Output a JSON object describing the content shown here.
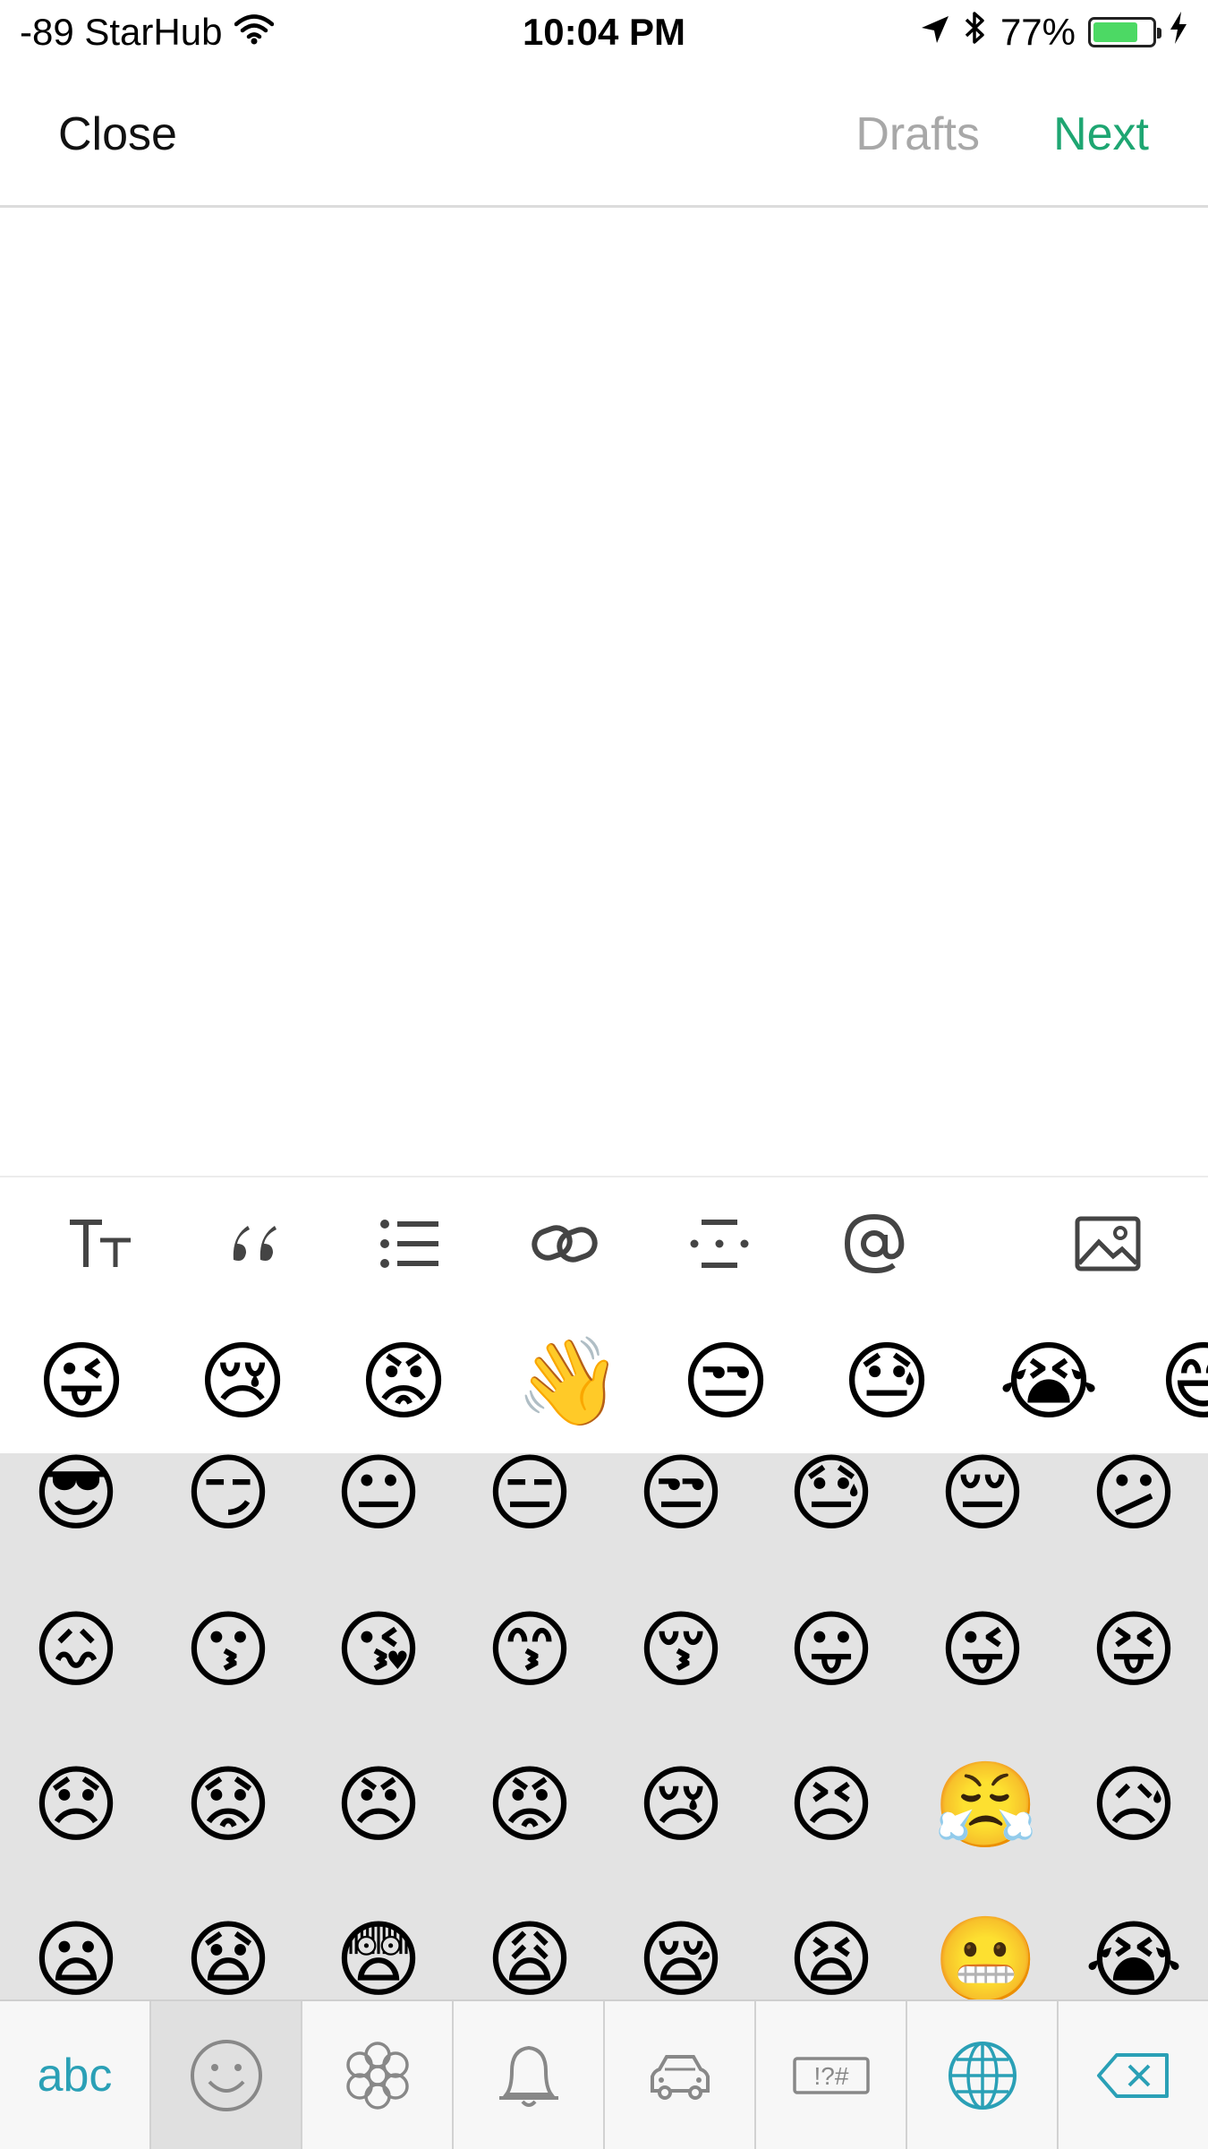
{
  "status_bar": {
    "signal": "-89 StarHub",
    "time": "10:04 PM",
    "battery": "77%",
    "battery_level": 0.77
  },
  "nav": {
    "close_label": "Close",
    "drafts_label": "Drafts",
    "next_label": "Next"
  },
  "colors": {
    "accent": "#1ea672",
    "drafts": "#a8a8a8",
    "keyboard_bg": "#e3e3e3",
    "abc": "#2aa0b6"
  },
  "toolbar": {
    "icons": [
      "text-size-icon",
      "quote-icon",
      "list-icon",
      "link-icon",
      "divider-icon",
      "mention-icon",
      "image-icon"
    ]
  },
  "recent_emojis": [
    "😜",
    "😢",
    "😡",
    "👋",
    "😒",
    "😓",
    "😭",
    "😄"
  ],
  "emoji_grid": [
    [
      "😎",
      "😏",
      "😐",
      "😑",
      "😒",
      "😓",
      "😔",
      "😕"
    ],
    [
      "😖",
      "😗",
      "😘",
      "😙",
      "😚",
      "😛",
      "😜",
      "😝"
    ],
    [
      "😞",
      "😟",
      "😠",
      "😡",
      "😢",
      "😣",
      "😤",
      "😥"
    ],
    [
      "😦",
      "😧",
      "😨",
      "😩",
      "😪",
      "😫",
      "😬",
      "😭"
    ]
  ],
  "keyboard": {
    "abc_label": "abc",
    "categories": [
      "abc",
      "smiley-icon",
      "flower-icon",
      "bell-icon",
      "car-icon",
      "symbols-icon",
      "globe-icon",
      "backspace-icon"
    ],
    "symbols_label": "!?#"
  }
}
